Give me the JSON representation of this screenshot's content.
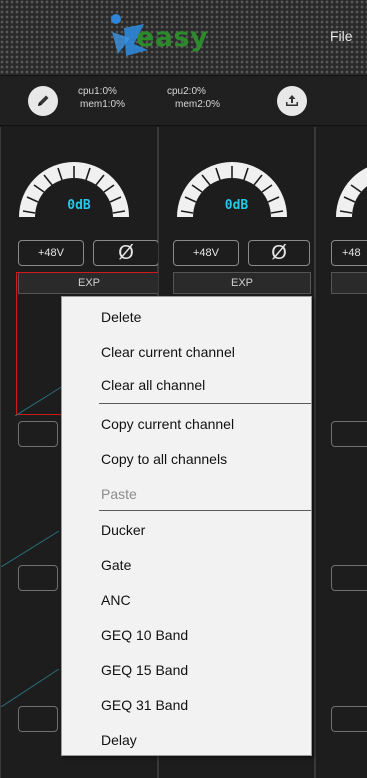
{
  "app": {
    "logo_text": "easy",
    "menu_file": "File"
  },
  "status": {
    "cpu1": "cpu1:0%",
    "mem1": "mem1:0%",
    "cpu2": "cpu2:0%",
    "mem2": "mem2:0%"
  },
  "channels": [
    {
      "gain": "0dB",
      "phantom": "+48V",
      "phase": "Ø",
      "exp": "EXP"
    },
    {
      "gain": "0dB",
      "phantom": "+48V",
      "phase": "Ø",
      "exp": "EXP"
    },
    {
      "phantom": "+48"
    }
  ],
  "context_menu": {
    "items": [
      {
        "label": "Delete",
        "enabled": true
      },
      {
        "label": "Clear current channel",
        "enabled": true
      },
      {
        "label": "Clear all channel",
        "enabled": true
      },
      {
        "label": "Copy current channel",
        "enabled": true
      },
      {
        "label": "Copy to all channels",
        "enabled": true
      },
      {
        "label": "Paste",
        "enabled": false
      },
      {
        "label": "Ducker",
        "enabled": true
      },
      {
        "label": "Gate",
        "enabled": true
      },
      {
        "label": "ANC",
        "enabled": true
      },
      {
        "label": "GEQ 10 Band",
        "enabled": true
      },
      {
        "label": "GEQ 15 Band",
        "enabled": true
      },
      {
        "label": "GEQ 31 Band",
        "enabled": true
      },
      {
        "label": "Delay",
        "enabled": true
      }
    ]
  },
  "colors": {
    "accent_cyan": "#26c6e6",
    "selection_red": "#d11a1a",
    "logo_green": "#2c8a2c",
    "logo_blue": "#2f86d8"
  }
}
